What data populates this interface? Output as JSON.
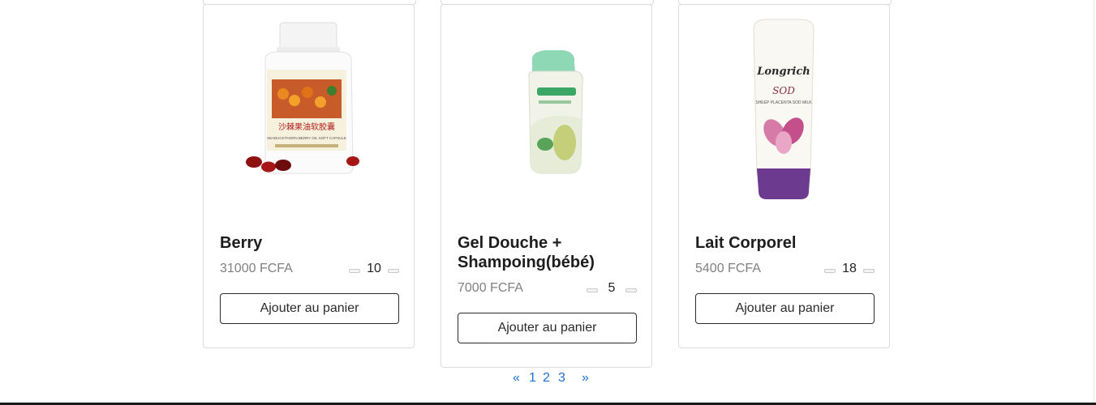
{
  "products": [
    {
      "name": "Berry",
      "price": "31000 FCFA",
      "quantity": "10",
      "button_label": "Ajouter au panier"
    },
    {
      "name": "Gel Douche + Shampoing(bébé)",
      "price": "7000 FCFA",
      "quantity": "5",
      "button_label": "Ajouter au panier"
    },
    {
      "name": "Lait Corporel",
      "price": "5400 FCFA",
      "quantity": "18",
      "button_label": "Ajouter au panier"
    }
  ],
  "product_images": {
    "berry": {
      "brand_text": "沙棘果油软胶囊",
      "subtext": "SEABUCKTHORN BERRY OIL SOFT CAPSULE"
    },
    "lotion": {
      "brand_text": "Longrich",
      "sub_brand": "SOD",
      "subtext": "SHEEP PLACENTA SOD MILK"
    }
  },
  "pagination": {
    "prev": "«",
    "pages": [
      "1",
      "2",
      "3"
    ],
    "next": "»"
  },
  "colors": {
    "link": "#1f6fd1",
    "price": "#808080",
    "border": "#dcdcdc"
  }
}
